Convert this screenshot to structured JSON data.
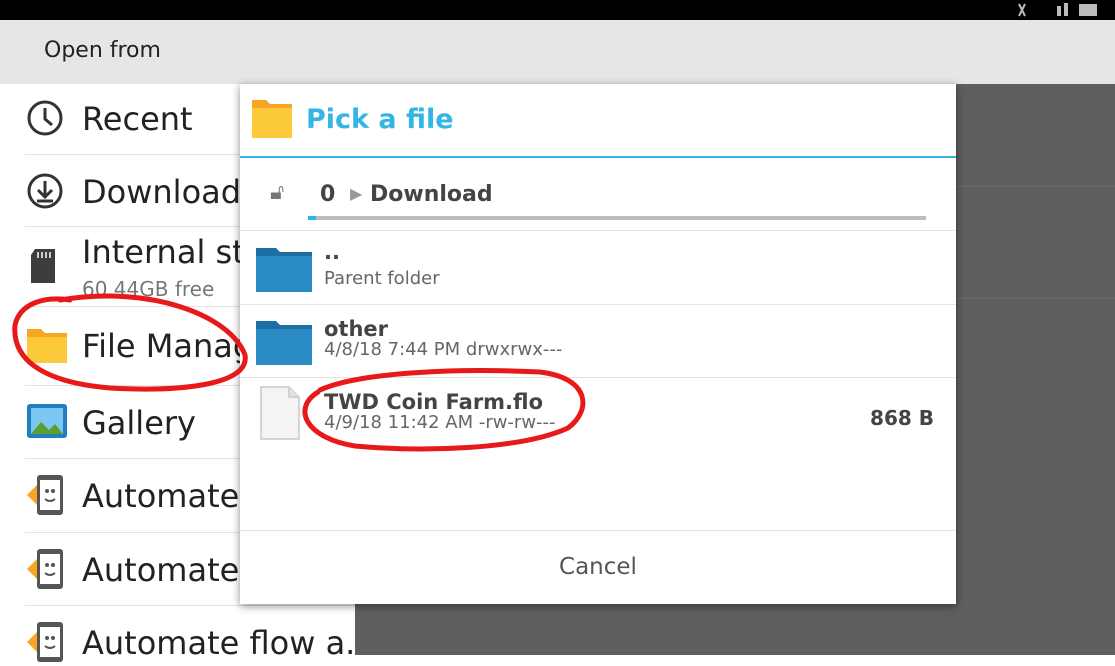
{
  "header": {
    "title": "Open from"
  },
  "sidebar": {
    "items": [
      {
        "label": "Recent",
        "icon": "clock-icon"
      },
      {
        "label": "Downloads",
        "icon": "download-icon"
      },
      {
        "label": "Internal sto",
        "sublabel": "60.44GB free",
        "icon": "sd-card-icon"
      },
      {
        "label": "File Manag",
        "icon": "folder-icon"
      },
      {
        "label": "Gallery",
        "icon": "gallery-icon"
      },
      {
        "label": "Automate f",
        "icon": "automate-icon"
      },
      {
        "label": "Automate f",
        "icon": "automate-icon"
      },
      {
        "label": "Automate flow a...",
        "icon": "automate-icon"
      }
    ]
  },
  "dialog": {
    "title": "Pick a file",
    "breadcrumb": [
      "0",
      "Download"
    ],
    "files": [
      {
        "name": "..",
        "meta": "Parent folder",
        "type": "folder",
        "size": ""
      },
      {
        "name": "other",
        "meta": "4/8/18 7:44 PM  drwxrwx---",
        "type": "folder",
        "size": ""
      },
      {
        "name": "TWD Coin Farm.flo",
        "meta": "4/9/18 11:42 AM  -rw-rw---",
        "type": "file",
        "size": "868 B"
      }
    ],
    "cancel_label": "Cancel"
  },
  "colors": {
    "accent": "#33b5e5",
    "annotation": "#e8191a"
  }
}
